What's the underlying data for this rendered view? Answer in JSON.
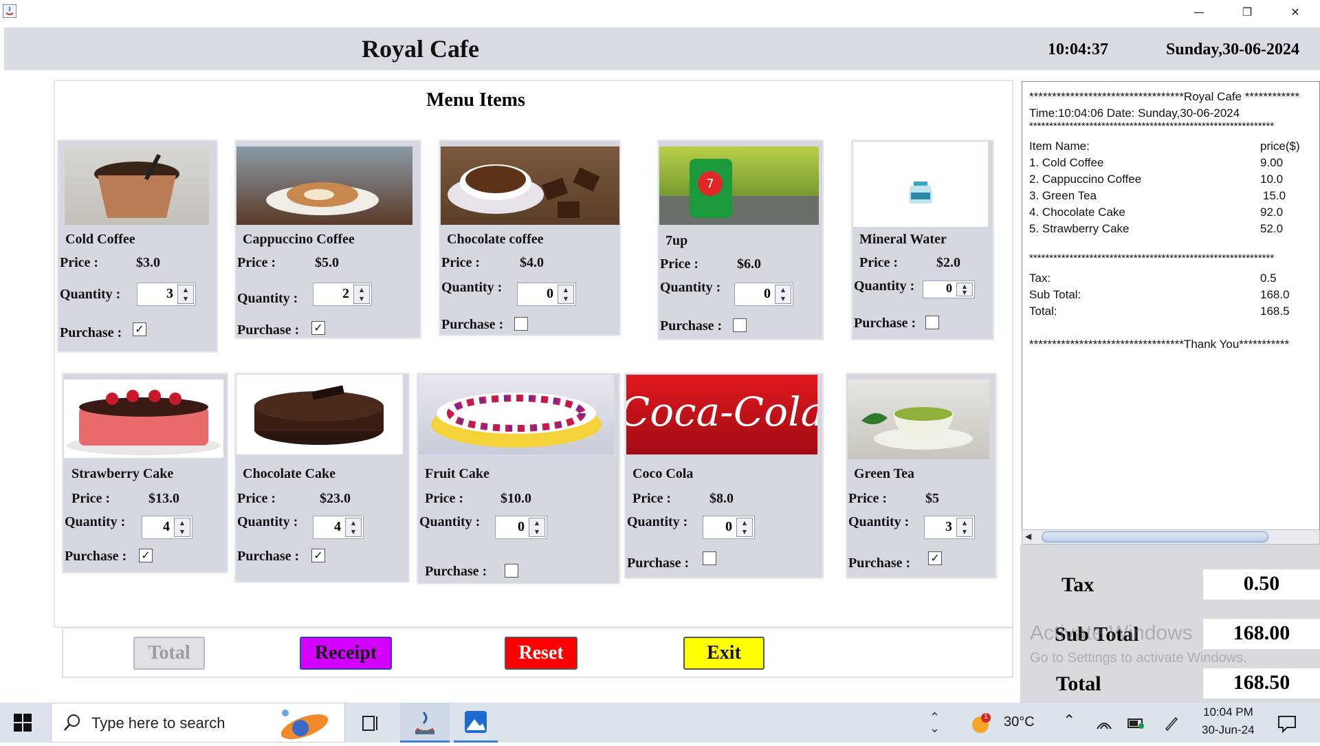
{
  "header": {
    "title": "Royal Cafe",
    "time": "10:04:37",
    "date": "Sunday,30-06-2024"
  },
  "menu": {
    "title": "Menu Items",
    "price_label": "Price :",
    "quantity_label": "Quantity :",
    "purchase_label": "Purchase :",
    "items": [
      {
        "name": "Cold Coffee",
        "price": "$3.0",
        "quantity": "3",
        "purchased": "✓"
      },
      {
        "name": "Cappuccino Coffee",
        "price": "$5.0",
        "quantity": "2",
        "purchased": "✓"
      },
      {
        "name": "Chocolate coffee",
        "price": "$4.0",
        "quantity": "0",
        "purchased": ""
      },
      {
        "name": "7up",
        "price": "$6.0",
        "quantity": "0",
        "purchased": ""
      },
      {
        "name": "Mineral Water",
        "price": "$2.0",
        "quantity": "0",
        "purchased": ""
      },
      {
        "name": "Strawberry Cake",
        "price": "$13.0",
        "quantity": "4",
        "purchased": "✓"
      },
      {
        "name": "Chocolate Cake",
        "price": "$23.0",
        "quantity": "4",
        "purchased": "✓"
      },
      {
        "name": "Fruit Cake",
        "price": "$10.0",
        "quantity": "0",
        "purchased": ""
      },
      {
        "name": "Coco Cola",
        "price": "$8.0",
        "quantity": "0",
        "purchased": ""
      },
      {
        "name": "Green Tea",
        "price": "$5",
        "quantity": "3",
        "purchased": "✓"
      }
    ]
  },
  "buttons": {
    "total": "Total",
    "receipt": "Receipt",
    "reset": "Reset",
    "exit": "Exit"
  },
  "receipt": {
    "header_line": "**********************************Royal Cafe ************",
    "time_line": "Time:10:04:06 Date: Sunday,30-06-2024",
    "stars": "*************************************************************",
    "col_item": "Item Name:",
    "col_price": "price($)",
    "lines": [
      {
        "item": "1. Cold Coffee",
        "price": "9.00"
      },
      {
        "item": "2. Cappuccino Coffee",
        "price": "10.0"
      },
      {
        "item": "3. Green Tea",
        "price": "15.0"
      },
      {
        "item": "4. Chocolate Cake",
        "price": "92.0"
      },
      {
        "item": "5. Strawberry Cake",
        "price": "52.0"
      }
    ],
    "tax_label": "Tax:",
    "tax": "0.5",
    "subtotal_label": "Sub Total:",
    "subtotal": "168.0",
    "total_label": "Total:",
    "total": "168.5",
    "footer": "**********************************Thank You***********"
  },
  "totals": {
    "tax_label": "Tax",
    "tax": "0.50",
    "subtotal_label": "Sub Total",
    "subtotal": "168.00",
    "total_label": "Total",
    "total": "168.50"
  },
  "watermark": {
    "line1": "Activate Windows",
    "line2": "Go to Settings to activate Windows."
  },
  "taskbar": {
    "search_placeholder": "Type here to search",
    "weather": "30°C",
    "clock_time": "10:04 PM",
    "clock_date": "30-Jun-24",
    "weather_badge": "1"
  },
  "colors": {
    "header_bg": "#d9dbe3",
    "card_bg": "#d5d8e1",
    "receipt_btn": "#d400ff",
    "reset_btn": "#ff0000",
    "exit_btn": "#ffff00"
  },
  "icons": [
    "java-icon",
    "minimize-icon",
    "restore-icon",
    "close-icon",
    "windows-start-icon",
    "search-icon",
    "task-view-icon",
    "java-taskbar-icon",
    "photos-taskbar-icon",
    "weather-icon",
    "chevron-up-icon",
    "wifi-icon",
    "battery-icon",
    "pen-icon",
    "notification-icon"
  ]
}
